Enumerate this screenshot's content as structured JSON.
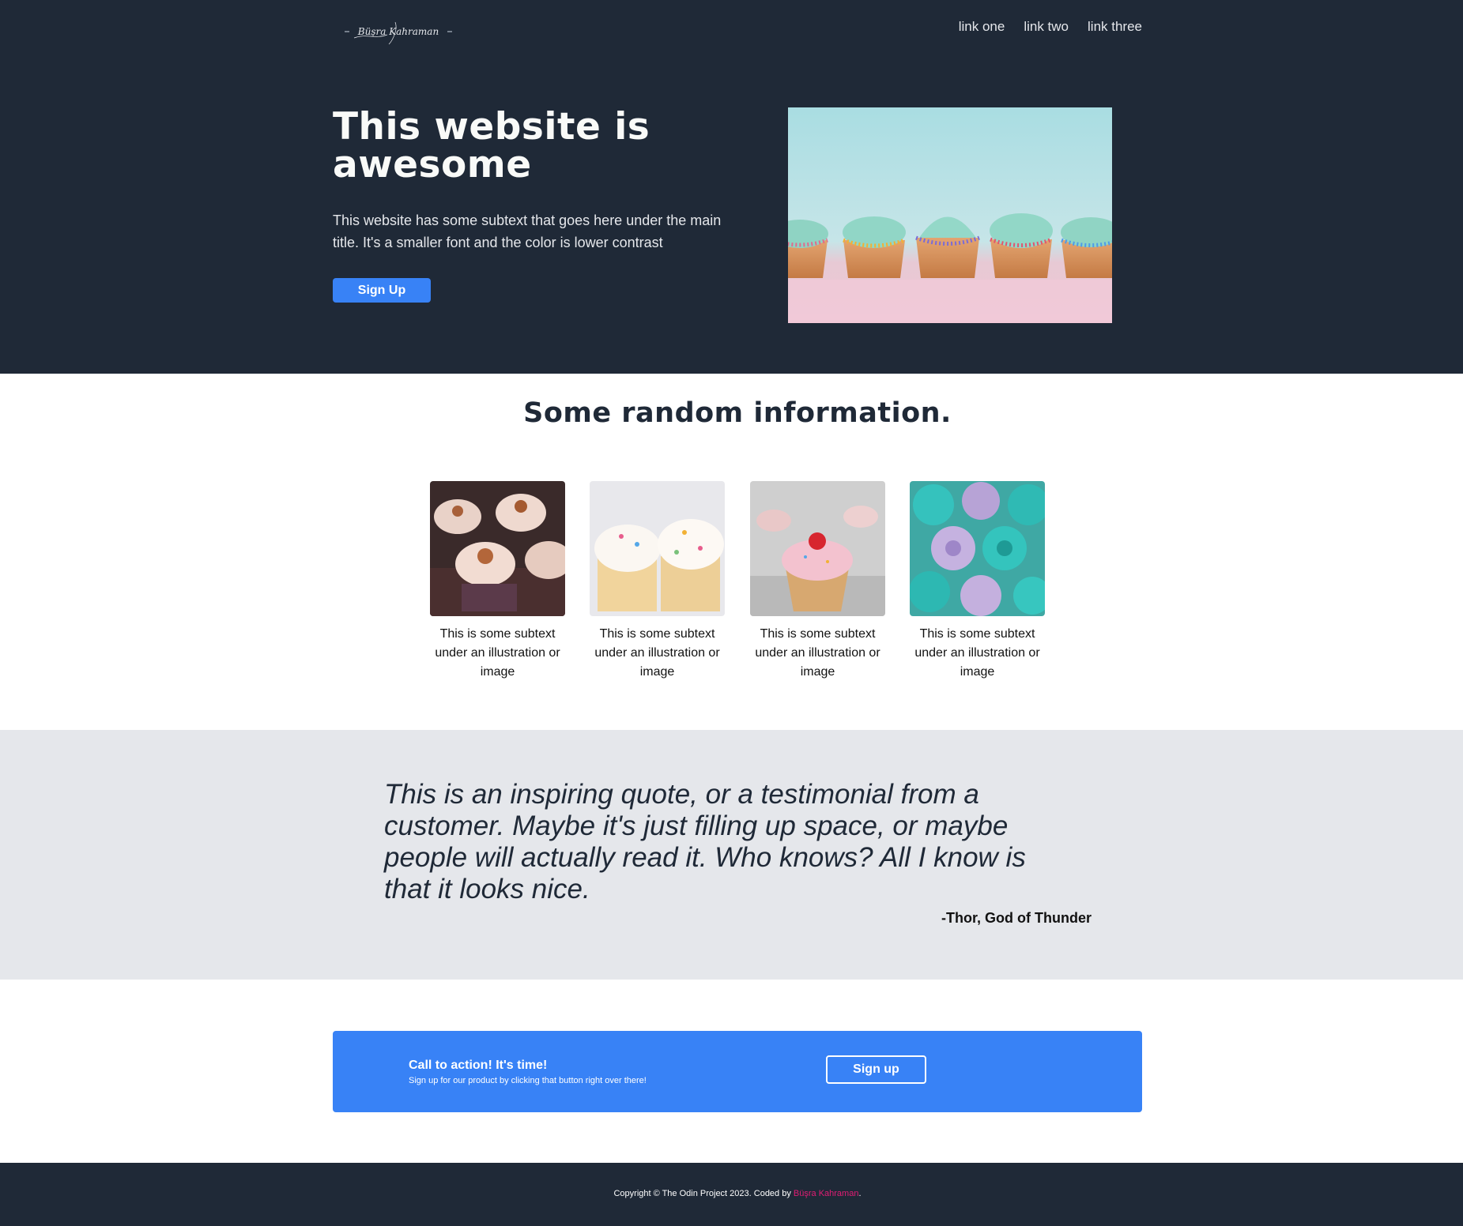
{
  "header": {
    "logo_text": "Büşra Kahraman",
    "nav": [
      "link one",
      "link two",
      "link three"
    ]
  },
  "hero": {
    "title": "This website is awesome",
    "subtitle": "This website has some subtext that goes here under the main title. It's a smaller font and the color is lower contrast",
    "button_label": "Sign Up",
    "image": "cupcakes-row-photo"
  },
  "info": {
    "title": "Some random information.",
    "cards": [
      {
        "caption": "This is some subtext under an illustration or image",
        "image": "chocolate-cupcakes-photo"
      },
      {
        "caption": "This is some subtext under an illustration or image",
        "image": "vanilla-sprinkle-cupcakes-photo"
      },
      {
        "caption": "This is some subtext under an illustration or image",
        "image": "pink-cherry-cupcake-photo"
      },
      {
        "caption": "This is some subtext under an illustration or image",
        "image": "teal-swirl-cupcakes-photo"
      }
    ]
  },
  "quote": {
    "text": "This is an inspiring quote, or a testimonial from a customer. Maybe it's just filling up space, or maybe people will actually read it. Who knows? All I know is that it looks nice.",
    "author": "-Thor, God of Thunder"
  },
  "cta": {
    "title": "Call to action! It's time!",
    "subtitle": "Sign up for our product by clicking that button right over there!",
    "button_label": "Sign up"
  },
  "footer": {
    "prefix": "Copyright © The Odin Project 2023. Coded by ",
    "author": "Büşra Kahraman",
    "suffix": "."
  },
  "colors": {
    "dark": "#1f2937",
    "accent_blue": "#3882f6",
    "quote_bg": "#e5e7eb",
    "footer_accent": "#e11d74"
  }
}
